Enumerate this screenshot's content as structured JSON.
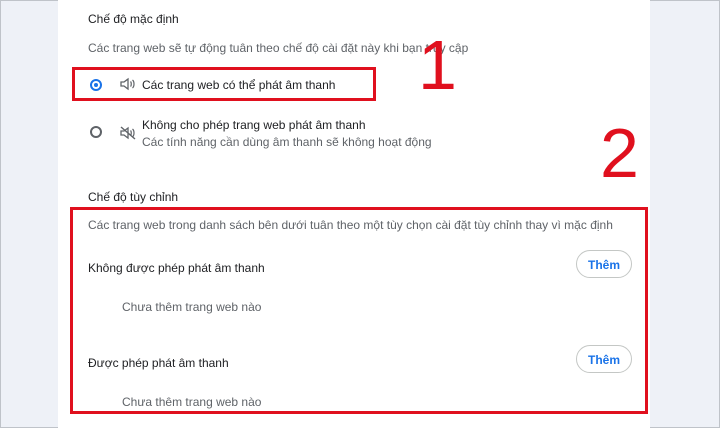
{
  "default_mode": {
    "heading": "Chế độ mặc định",
    "description": "Các trang web sẽ tự động tuân theo chế độ cài đặt này khi bạn truy cập",
    "options": [
      {
        "label": "Các trang web có thể phát âm thanh",
        "sublabel": "",
        "selected": true,
        "icon": "speaker-icon"
      },
      {
        "label": "Không cho phép trang web phát âm thanh",
        "sublabel": "Các tính năng cần dùng âm thanh sẽ không hoạt động",
        "selected": false,
        "icon": "speaker-muted-icon"
      }
    ]
  },
  "custom_mode": {
    "heading": "Chế độ tùy chỉnh",
    "description": "Các trang web trong danh sách bên dưới tuân theo một tùy chọn cài đặt tùy chỉnh thay vì mặc định",
    "sections": [
      {
        "title": "Không được phép phát âm thanh",
        "button": "Thêm",
        "empty": "Chưa thêm trang web nào"
      },
      {
        "title": "Được phép phát âm thanh",
        "button": "Thêm",
        "empty": "Chưa thêm trang web nào"
      }
    ]
  },
  "annotations": {
    "label_1": "1",
    "label_2": "2",
    "color": "#e0101e"
  },
  "colors": {
    "accent": "#1a73e8",
    "background": "#eef1f7",
    "panel": "#ffffff"
  }
}
